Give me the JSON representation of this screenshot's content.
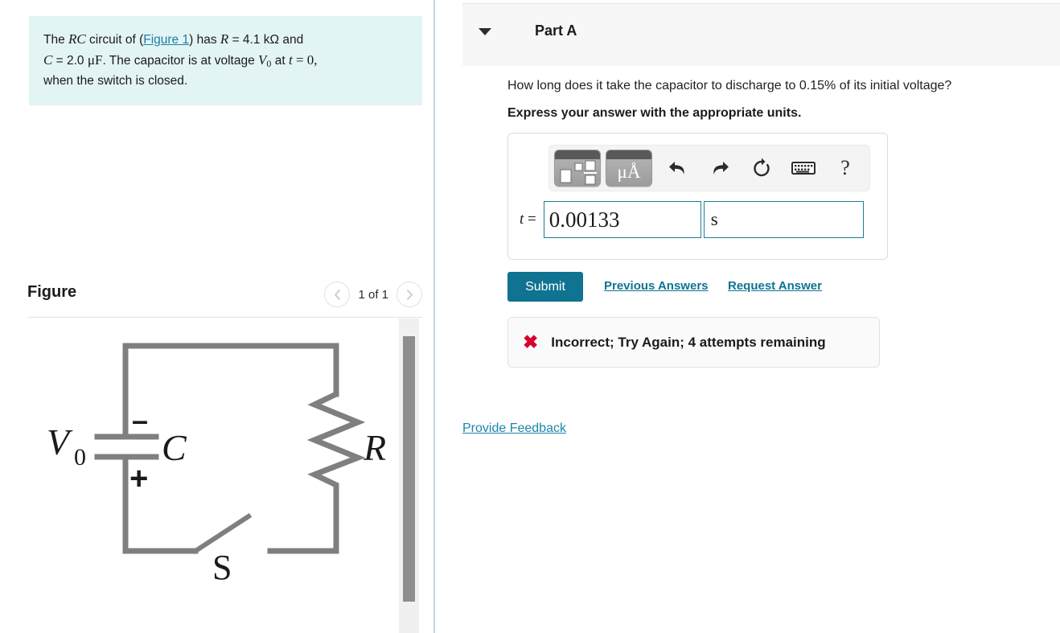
{
  "problem": {
    "line1_pre": "The ",
    "line1_rc": "RC",
    "line1_mid": " circuit of (",
    "figure_link": "Figure 1",
    "line1_post": ") has ",
    "line1_r": "R",
    "line1_rval": " = 4.1 kΩ and",
    "line2_c": "C",
    "line2_cval": " = 2.0 ",
    "line2_unit": "μF",
    "line2_mid": ". The capacitor is at voltage ",
    "line2_v": "V",
    "line2_vsub": "0",
    "line2_at": " at ",
    "line2_t": "t",
    "line2_teq": " = 0,",
    "line3": "when the switch is closed."
  },
  "figure": {
    "title": "Figure",
    "count_label": "1 of 1",
    "prev_icon": "chevron-left-icon",
    "next_icon": "chevron-right-icon",
    "circuit": {
      "source_label": "V",
      "source_sub": "0",
      "capacitor_label": "C",
      "resistor_label": "R",
      "switch_label": "S",
      "plus_sign": "+",
      "minus_sign": "−",
      "wire_color": "#7f7f7f"
    }
  },
  "part": {
    "caret_icon": "caret-down-icon",
    "label": "Part A",
    "question": "How long does it take the capacitor to discharge to 0.15% of its initial voltage?",
    "instruction": "Express your answer with the appropriate units."
  },
  "toolbar": {
    "template_icon": "math-template-palette-icon",
    "units_icon": "units-palette-icon",
    "units_icon_label": "μÅ",
    "undo_icon": "undo-icon",
    "redo_icon": "redo-icon",
    "reset_icon": "reset-icon",
    "keyboard_icon": "keyboard-icon",
    "help_icon": "?"
  },
  "answer": {
    "variable_label": "t",
    "equals": "=",
    "value": "0.00133",
    "unit": "s",
    "value_placeholder": "",
    "unit_placeholder": "",
    "border_color": "#1c7e95"
  },
  "actions": {
    "submit_label": "Submit",
    "previous_answers_label": "Previous Answers",
    "request_answer_label": "Request Answer",
    "submit_color": "#0f7391"
  },
  "status": {
    "icon": "x-mark-icon",
    "icon_glyph": "✖",
    "icon_color": "#d8022e",
    "message": "Incorrect; Try Again; 4 attempts remaining"
  },
  "feedback": {
    "label": "Provide Feedback",
    "color": "#1b86ac"
  },
  "scrollbar": {
    "orientation": "vertical"
  }
}
